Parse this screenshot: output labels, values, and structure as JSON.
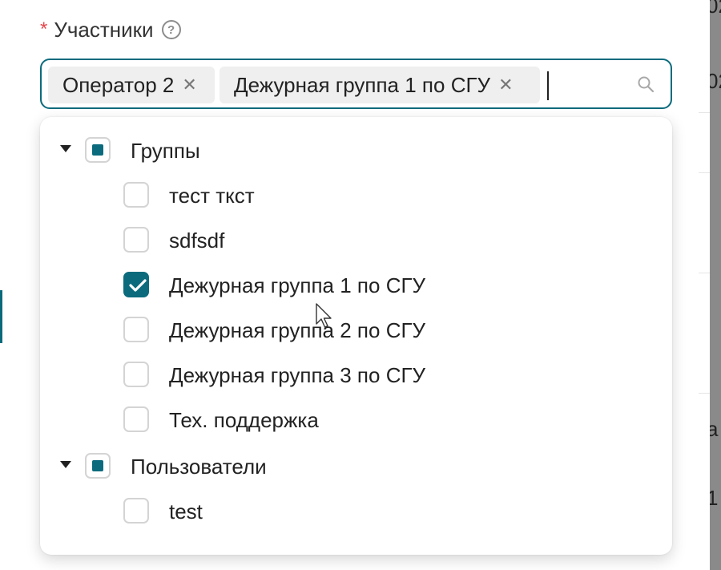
{
  "field": {
    "required_mark": "*",
    "label": "Участники",
    "help_icon_glyph": "?"
  },
  "select": {
    "selected_tags": [
      {
        "label": "Оператор 2",
        "remove_glyph": "✕"
      },
      {
        "label": "Дежурная группа 1 по СГУ",
        "remove_glyph": "✕"
      }
    ],
    "search_value": "",
    "search_icon": "search-icon"
  },
  "tree": {
    "groups_node": {
      "label": "Группы",
      "expanded": true,
      "state": "indeterminate",
      "children": [
        {
          "label": "тест ткст",
          "checked": false
        },
        {
          "label": "sdfsdf",
          "checked": false
        },
        {
          "label": "Дежурная группа 1 по СГУ",
          "checked": true
        },
        {
          "label": "Дежурная группа 2 по СГУ",
          "checked": false
        },
        {
          "label": "Дежурная группа 3 по СГУ",
          "checked": false
        },
        {
          "label": "Тех. поддержка",
          "checked": false
        }
      ]
    },
    "users_node": {
      "label": "Пользователи",
      "expanded": true,
      "state": "indeterminate",
      "children": [
        {
          "label": "test",
          "checked": false
        }
      ]
    }
  },
  "background": {
    "edge_fragments": [
      "02",
      "02",
      "a",
      "1"
    ]
  },
  "colors": {
    "accent": "#0b6b7d",
    "required": "#e5484d",
    "tag_bg": "#efefef"
  }
}
